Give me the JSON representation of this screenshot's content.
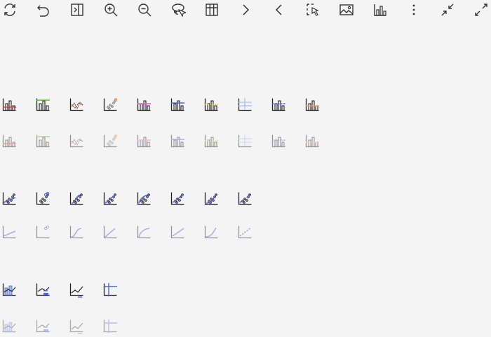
{
  "toolbar": {
    "buttons": [
      {
        "name": "refresh-icon"
      },
      {
        "name": "undo-icon"
      },
      {
        "name": "toggle-panel-icon"
      },
      {
        "name": "zoom-in-icon"
      },
      {
        "name": "zoom-out-icon"
      },
      {
        "name": "lasso-select-icon"
      },
      {
        "name": "data-table-icon"
      },
      {
        "name": "chevron-right-icon"
      },
      {
        "name": "chevron-left-icon"
      },
      {
        "name": "box-select-icon"
      },
      {
        "name": "image-icon"
      },
      {
        "name": "chart-icon"
      },
      {
        "name": "more-vertical-icon"
      },
      {
        "name": "shrink-icon"
      },
      {
        "name": "expand-icon"
      }
    ]
  },
  "colors": {
    "toolbar_icon": "#333333",
    "icon_stroke": "#222222",
    "grid": "#cccccc",
    "red": "#e0413b",
    "green": "#55b62a",
    "brown": "#b0745a",
    "orange": "#f29a4b",
    "pink": "#e85bd7",
    "blue": "#4a66d6",
    "yellow": "#e6c21f",
    "lightblue": "#a9b9ec",
    "salmon": "#ee9a6d"
  },
  "icon_groups": {
    "reference_lines": [
      "red-reference-line-icon",
      "green-bar-line-icon",
      "brown-line-icon",
      "scatter-orange-point-icon",
      "pink-reference-line-icon",
      "blue-reference-line-icon",
      "yellow-dashed-line-icon",
      "crosshair-grid-icon",
      "blue-dashed-line-icon",
      "orange-reference-line-icon"
    ],
    "trend_lines": [
      "linear-trend-icon",
      "scatter-trend-icon",
      "polynomial-trend-icon",
      "log-trend-icon",
      "power-trend-icon",
      "exponential-trend-icon",
      "loess-trend-icon",
      "dashed-trend-icon"
    ],
    "distribution": [
      "box-plot-icon",
      "band-icon",
      "arrow-line-icon",
      "crosshair-icon"
    ]
  }
}
